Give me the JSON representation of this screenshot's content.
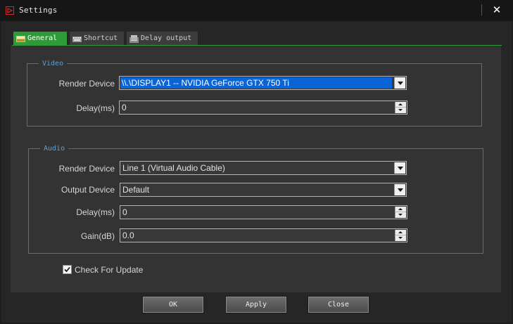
{
  "window": {
    "title": "Settings"
  },
  "tabs": [
    {
      "label": "General",
      "icon": "general-icon",
      "active": true
    },
    {
      "label": "Shortcut",
      "icon": "keyboard-icon",
      "active": false
    },
    {
      "label": "Delay output",
      "icon": "clock-icon",
      "active": false
    }
  ],
  "video": {
    "legend": "Video",
    "render_device_label": "Render Device",
    "render_device_value": "\\\\.\\DISPLAY1 -- NVIDIA GeForce GTX 750 Ti",
    "delay_label": "Delay(ms)",
    "delay_value": "0"
  },
  "audio": {
    "legend": "Audio",
    "render_device_label": "Render Device",
    "render_device_value": "Line 1 (Virtual Audio Cable)",
    "output_device_label": "Output Device",
    "output_device_value": "Default",
    "delay_label": "Delay(ms)",
    "delay_value": "0",
    "gain_label": "Gain(dB)",
    "gain_value": "0.0"
  },
  "options": {
    "check_update_label": "Check For Update",
    "check_update_checked": true
  },
  "buttons": {
    "ok": "OK",
    "apply": "Apply",
    "close": "Close"
  },
  "colors": {
    "accent_green": "#2e9c36",
    "legend_blue": "#5aa0d8",
    "selection_blue": "#0a64d6",
    "close_red": "#d02a2a"
  }
}
